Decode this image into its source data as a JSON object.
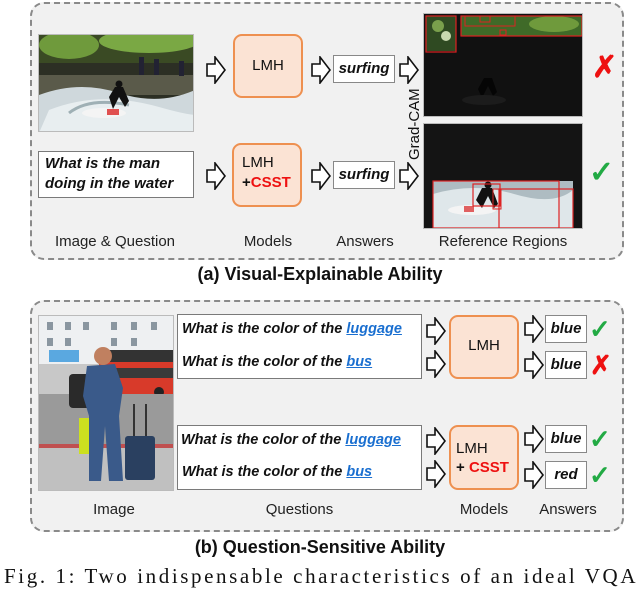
{
  "panel_a": {
    "title": "(a) Visual-Explainable Ability",
    "question": "What is the man doing in the water",
    "models": [
      {
        "name": "LMH",
        "addon": ""
      },
      {
        "name": "LMH",
        "addon_prefix": "+",
        "addon": "CSST"
      }
    ],
    "answers": [
      "surfing",
      "surfing"
    ],
    "gradcam_label": "Grad-CAM",
    "results": [
      {
        "icon": "cross-icon",
        "glyph": "✗",
        "color": "#ee1111"
      },
      {
        "icon": "check-icon",
        "glyph": "✓",
        "color": "#22aa44"
      }
    ],
    "column_labels": [
      "Image & Question",
      "Models",
      "Answers",
      "Reference Regions"
    ]
  },
  "panel_b": {
    "title": "(b) Question-Sensitive Ability",
    "question_prefix": "What is the color of the ",
    "question_groups": [
      [
        {
          "target": "luggage"
        },
        {
          "target": "bus"
        }
      ],
      [
        {
          "target": "luggage"
        },
        {
          "target": "bus"
        }
      ]
    ],
    "models": [
      {
        "name": "LMH",
        "addon": ""
      },
      {
        "name": "LMH",
        "addon_prefix": "+ ",
        "addon": "CSST"
      }
    ],
    "answers": [
      "blue",
      "blue",
      "blue",
      "red"
    ],
    "results": [
      {
        "icon": "check-icon",
        "glyph": "✓"
      },
      {
        "icon": "cross-icon",
        "glyph": "✗"
      },
      {
        "icon": "check-icon",
        "glyph": "✓"
      },
      {
        "icon": "check-icon",
        "glyph": "✓"
      }
    ],
    "column_labels": [
      "Image",
      "Questions",
      "Models",
      "Answers"
    ]
  },
  "caption": "Fig. 1: Two indispensable characteristics of an ideal VQA"
}
